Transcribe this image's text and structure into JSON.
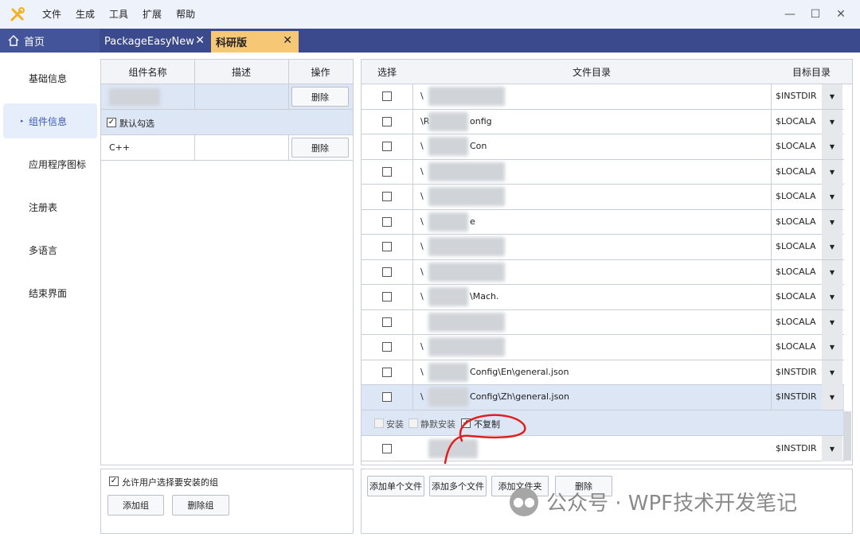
{
  "menu": {
    "items": [
      "文件",
      "生成",
      "工具",
      "扩展",
      "帮助"
    ]
  },
  "window": {
    "minimize": "—",
    "maximize": "☐",
    "close": "✕"
  },
  "tabs": {
    "home": "首页",
    "items": [
      {
        "label": "PackageEasyNew",
        "close": "✕"
      },
      {
        "label": "科研版",
        "close": "✕"
      }
    ]
  },
  "sidebar": {
    "items": [
      "基础信息",
      "组件信息",
      "应用程序图标",
      "注册表",
      "多语言",
      "结束界面"
    ],
    "active_index": 1
  },
  "components": {
    "headers": {
      "name": "组件名称",
      "desc": "描述",
      "op": "操作"
    },
    "rows": [
      {
        "name": "",
        "desc": "",
        "op": "删除"
      },
      {
        "name": "C++",
        "desc": "",
        "op": "删除"
      }
    ],
    "default_check_label": "默认勾选",
    "allow_select_label": "允许用户选择要安装的组",
    "add_group": "添加组",
    "delete_group": "删除组"
  },
  "files": {
    "headers": {
      "select": "选择",
      "dir": "文件目录",
      "target": "目标目录"
    },
    "rows": [
      {
        "path": "\\",
        "target": "$INSTDIR"
      },
      {
        "path": "\\R",
        "suffix": "onfig",
        "target": "$LOCALA"
      },
      {
        "path": "\\",
        "suffix": "Con",
        "target": "$LOCALA"
      },
      {
        "path": "\\",
        "target": "$LOCALA"
      },
      {
        "path": "\\",
        "target": "$LOCALA"
      },
      {
        "path": "\\",
        "suffix": "e",
        "target": "$LOCALA"
      },
      {
        "path": "\\",
        "target": "$LOCALA"
      },
      {
        "path": "\\",
        "target": "$LOCALA"
      },
      {
        "path": "\\",
        "suffix": "\\Mach.",
        "target": "$LOCALA"
      },
      {
        "path": "",
        "target": "$LOCALA"
      },
      {
        "path": "\\",
        "target": "$LOCALA"
      },
      {
        "path": "\\",
        "suffix": "Config\\En\\general.json",
        "target": "$INSTDIR"
      },
      {
        "path": "\\",
        "suffix": "Config\\Zh\\general.json",
        "target": "$INSTDIR"
      }
    ],
    "options": {
      "install": "安装",
      "silent": "静默安装",
      "nocopy": "不复制"
    },
    "last_row": {
      "target": "$INSTDIR"
    },
    "buttons": {
      "add_single": "添加单个文件",
      "add_multi": "添加多个文件",
      "add_folder": "添加文件夹",
      "delete": "删除"
    }
  },
  "watermark": "公众号 · WPF技术开发笔记",
  "colors": {
    "accent": "#3b4a8c",
    "active_tab": "#f6c875",
    "selected_row": "#dce6f5",
    "annotation": "#e02020"
  }
}
